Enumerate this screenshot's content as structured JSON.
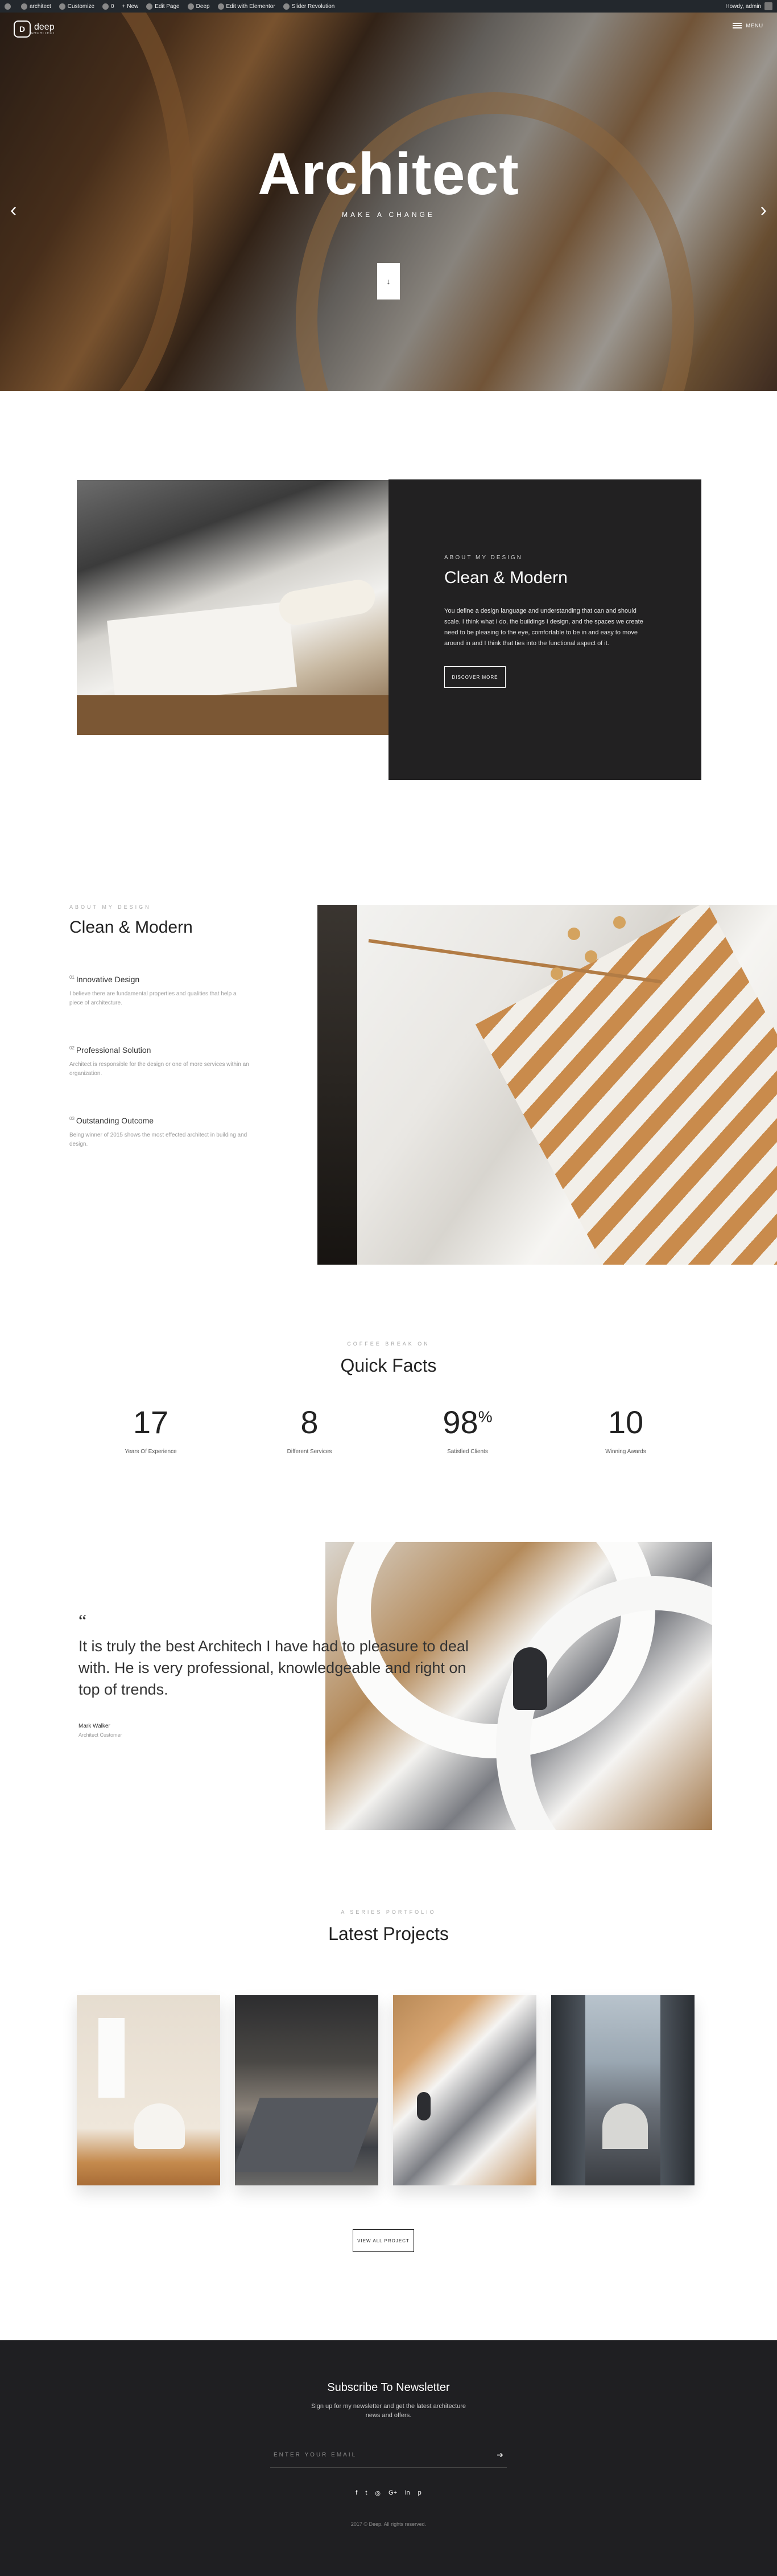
{
  "adminbar": {
    "site_name": "architect",
    "customize": "Customize",
    "comments": "0",
    "new": "+ New",
    "edit_page": "Edit Page",
    "deep": "Deep",
    "elementor": "Edit with Elementor",
    "slider": "Slider Revolution",
    "howdy": "Howdy, admin"
  },
  "hero": {
    "logo_mark": "D",
    "logo_name": "deep",
    "logo_sub": "ARCHITECT",
    "menu_label": "MENU",
    "title": "Architect",
    "tagline": "MAKE A CHANGE",
    "scroll_arrow": "↓",
    "prev_arrow": "‹",
    "next_arrow": "›"
  },
  "about": {
    "eyebrow": "ABOUT MY DESIGN",
    "title": "Clean & Modern",
    "body": "You define a design language and understanding that can and should scale. I think what I do, the buildings I design, and the spaces we create need to be pleasing to the eye, comfortable to be in and easy to move around in and I think that ties into the functional aspect of it.",
    "button": "DISCOVER MORE"
  },
  "features": {
    "eyebrow": "ABOUT MY DESIGN",
    "title": "Clean & Modern",
    "items": [
      {
        "num": "01",
        "title": "Innovative Design",
        "desc": "I believe there are fundamental properties and qualities that help a piece of architecture."
      },
      {
        "num": "02",
        "title": "Professional Solution",
        "desc": "Architect is responsible for the design or one of more services within an organization."
      },
      {
        "num": "03",
        "title": "Outstanding Outcome",
        "desc": "Being winner of 2015 shows the most effected architect in building and design."
      }
    ]
  },
  "facts": {
    "eyebrow": "COFFEE BREAK ON",
    "title": "Quick Facts",
    "items": [
      {
        "value": "17",
        "suffix": "",
        "label": "Years Of Experience"
      },
      {
        "value": "8",
        "suffix": "",
        "label": "Different Services"
      },
      {
        "value": "98",
        "suffix": "%",
        "label": "Satisfied Clients"
      },
      {
        "value": "10",
        "suffix": "",
        "label": "Winning Awards"
      }
    ]
  },
  "testimonial": {
    "quote_mark": "“",
    "text": "It is truly the best Architech I have had to pleasure to deal with. He is very professional, knowledgeable and right on top of trends.",
    "name": "Mark Walker",
    "role": "Architect Customer"
  },
  "portfolio": {
    "eyebrow": "A SERIES PORTFOLIO",
    "title": "Latest Projects",
    "button": "VIEW ALL PROJECT"
  },
  "footer": {
    "title": "Subscribe To Newsletter",
    "subtitle": "Sign up for my newsletter and get the latest architecture news and offers.",
    "email_placeholder": "ENTER YOUR EMAIL",
    "send_icon": "➔",
    "socials": [
      "f",
      "t",
      "◎",
      "G+",
      "in",
      "p"
    ],
    "copyright": "2017 © Deep. All rights reserved."
  }
}
